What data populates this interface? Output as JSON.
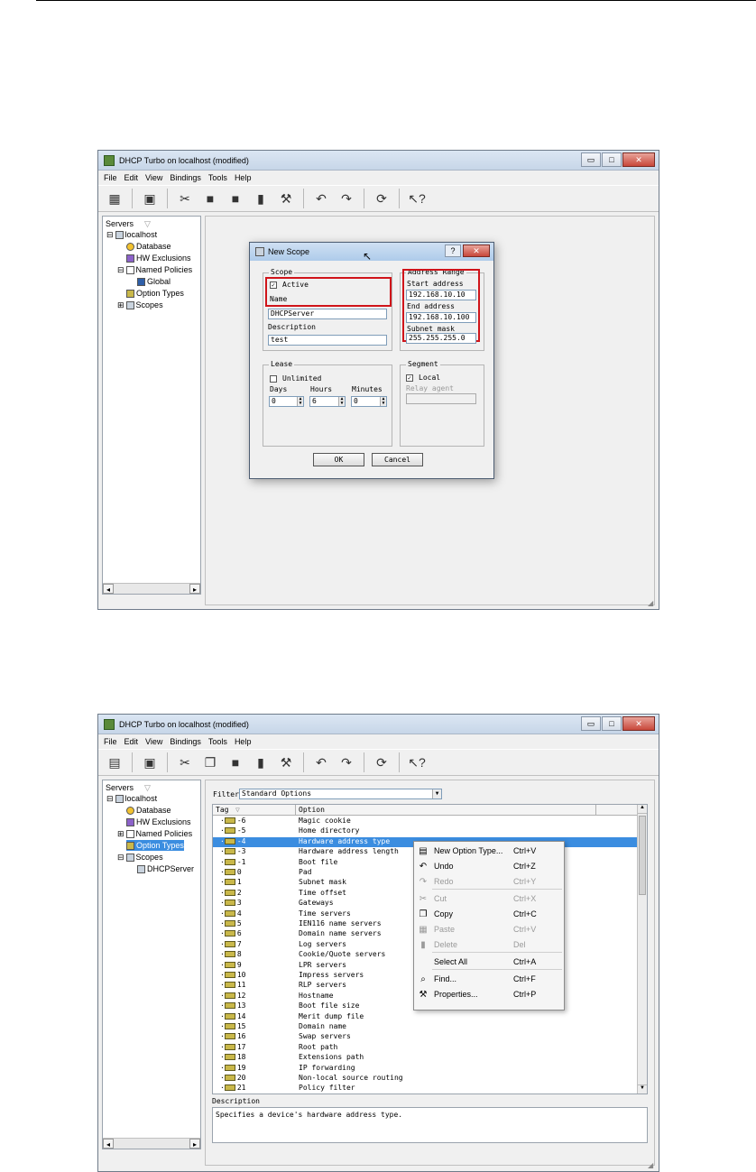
{
  "screen1": {
    "window_title": "DHCP Turbo on localhost (modified)",
    "menu": [
      "File",
      "Edit",
      "View",
      "Bindings",
      "Tools",
      "Help"
    ],
    "tree_header": "Servers",
    "tree": [
      "localhost",
      "Database",
      "HW Exclusions",
      "Named Policies",
      "Global",
      "Option Types",
      "Scopes"
    ],
    "dialog": {
      "title": "New Scope",
      "scope_group": "Scope",
      "active_label": "Active",
      "active_checked": true,
      "name_label": "Name",
      "name_value": "DHCPServer",
      "description_label": "Description",
      "description_value": "test",
      "address_group": "Address Range",
      "start_label": "Start address",
      "start_value": "192.168.10.10",
      "end_label": "End address",
      "end_value": "192.168.10.100",
      "mask_label": "Subnet mask",
      "mask_value": "255.255.255.0",
      "lease_group": "Lease",
      "unlimited_label": "Unlimited",
      "days_label": "Days",
      "days_value": "0",
      "hours_label": "Hours",
      "hours_value": "6",
      "minutes_label": "Minutes",
      "minutes_value": "0",
      "segment_group": "Segment",
      "local_label": "Local",
      "local_checked": true,
      "relay_label": "Relay agent",
      "ok_label": "OK",
      "cancel_label": "Cancel"
    }
  },
  "screen2": {
    "window_title": "DHCP Turbo on localhost (modified)",
    "menu": [
      "File",
      "Edit",
      "View",
      "Bindings",
      "Tools",
      "Help"
    ],
    "tree_header": "Servers",
    "tree": [
      "localhost",
      "Database",
      "HW Exclusions",
      "Named Policies",
      "Option Types",
      "Scopes",
      "DHCPServer"
    ],
    "filter_label": "Filter",
    "filter_value": "Standard Options",
    "columns": [
      "Tag",
      "Option"
    ],
    "rows": [
      {
        "tag": "-6",
        "option": "Magic cookie"
      },
      {
        "tag": "-5",
        "option": "Home directory"
      },
      {
        "tag": "-4",
        "option": "Hardware address type"
      },
      {
        "tag": "-3",
        "option": "Hardware address length"
      },
      {
        "tag": "-1",
        "option": "Boot file"
      },
      {
        "tag": "0",
        "option": "Pad"
      },
      {
        "tag": "1",
        "option": "Subnet mask"
      },
      {
        "tag": "2",
        "option": "Time offset"
      },
      {
        "tag": "3",
        "option": "Gateways"
      },
      {
        "tag": "4",
        "option": "Time servers"
      },
      {
        "tag": "5",
        "option": "IEN116 name servers"
      },
      {
        "tag": "6",
        "option": "Domain name servers"
      },
      {
        "tag": "7",
        "option": "Log servers"
      },
      {
        "tag": "8",
        "option": "Cookie/Quote servers"
      },
      {
        "tag": "9",
        "option": "LPR servers"
      },
      {
        "tag": "10",
        "option": "Impress servers"
      },
      {
        "tag": "11",
        "option": "RLP servers"
      },
      {
        "tag": "12",
        "option": "Hostname"
      },
      {
        "tag": "13",
        "option": "Boot file size"
      },
      {
        "tag": "14",
        "option": "Merit dump file"
      },
      {
        "tag": "15",
        "option": "Domain name"
      },
      {
        "tag": "16",
        "option": "Swap servers"
      },
      {
        "tag": "17",
        "option": "Root path"
      },
      {
        "tag": "18",
        "option": "Extensions path"
      },
      {
        "tag": "19",
        "option": "IP forwarding"
      },
      {
        "tag": "20",
        "option": "Non-local source routing"
      },
      {
        "tag": "21",
        "option": "Policy filter"
      }
    ],
    "selected_row": 2,
    "description_label": "Description",
    "description_value": "Specifies a device's hardware address type.",
    "context_menu": [
      {
        "label": "New Option Type...",
        "shortcut": "Ctrl+V",
        "icon": "new-option-icon",
        "enabled": true
      },
      {
        "label": "Undo",
        "shortcut": "Ctrl+Z",
        "icon": "undo-icon",
        "enabled": true
      },
      {
        "label": "Redo",
        "shortcut": "Ctrl+Y",
        "icon": "redo-icon",
        "enabled": false
      },
      {
        "label": "Cut",
        "shortcut": "Ctrl+X",
        "icon": "cut-icon",
        "enabled": false
      },
      {
        "label": "Copy",
        "shortcut": "Ctrl+C",
        "icon": "copy-icon",
        "enabled": true
      },
      {
        "label": "Paste",
        "shortcut": "Ctrl+V",
        "icon": "paste-icon",
        "enabled": false
      },
      {
        "label": "Delete",
        "shortcut": "Del",
        "icon": "delete-icon",
        "enabled": false
      },
      {
        "label": "Select All",
        "shortcut": "Ctrl+A",
        "icon": "",
        "enabled": true
      },
      {
        "label": "Find...",
        "shortcut": "Ctrl+F",
        "icon": "find-icon",
        "enabled": true
      },
      {
        "label": "Properties...",
        "shortcut": "Ctrl+P",
        "icon": "properties-icon",
        "enabled": true
      }
    ]
  },
  "colors": {
    "highlight": "#3b8de0",
    "annotation_red": "#d0141a"
  }
}
